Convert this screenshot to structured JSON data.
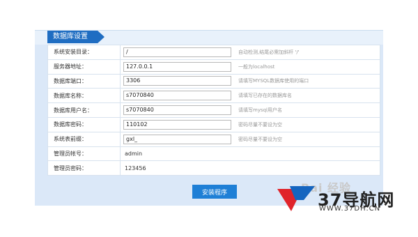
{
  "section_title": "数据库设置",
  "rows": [
    {
      "label": "系统安装目录：",
      "value": "/",
      "hint": "自动检测,结尾必需加斜杆 '/'",
      "type": "input"
    },
    {
      "label": "服务器地址：",
      "value": "127.0.0.1",
      "hint": "一般为localhost",
      "type": "input"
    },
    {
      "label": "数据库端口：",
      "value": "3306",
      "hint": "请填写MYSQL数据库使用的端口",
      "type": "input"
    },
    {
      "label": "数据库名称：",
      "value": "s7070840",
      "hint": "请填写已存在的数据库名",
      "type": "input"
    },
    {
      "label": "数据库用户名：",
      "value": "s7070840",
      "hint": "请填写mysql用户名",
      "type": "input"
    },
    {
      "label": "数据库密码：",
      "value": "110102",
      "hint": "密码尽量不要设为空",
      "type": "input"
    },
    {
      "label": "系统表前缀：",
      "value": "gxl_",
      "hint": "密码尽量不要设为空",
      "type": "input"
    },
    {
      "label": "管理员帐号：",
      "value": "admin",
      "hint": "",
      "type": "text"
    },
    {
      "label": "管理员密码：",
      "value": "123456",
      "hint": "",
      "type": "text"
    }
  ],
  "submit_label": "安装程序",
  "watermark": {
    "baidu": "Bai 经验",
    "site_name": "37导航网",
    "site_url": "WWW.37DH.CN"
  },
  "colors": {
    "accent": "#1f6dc2",
    "button": "#1e7fd6",
    "panel_bg": "#dbe8f8",
    "logo_red": "#e0242b",
    "logo_blue": "#1565c0"
  }
}
